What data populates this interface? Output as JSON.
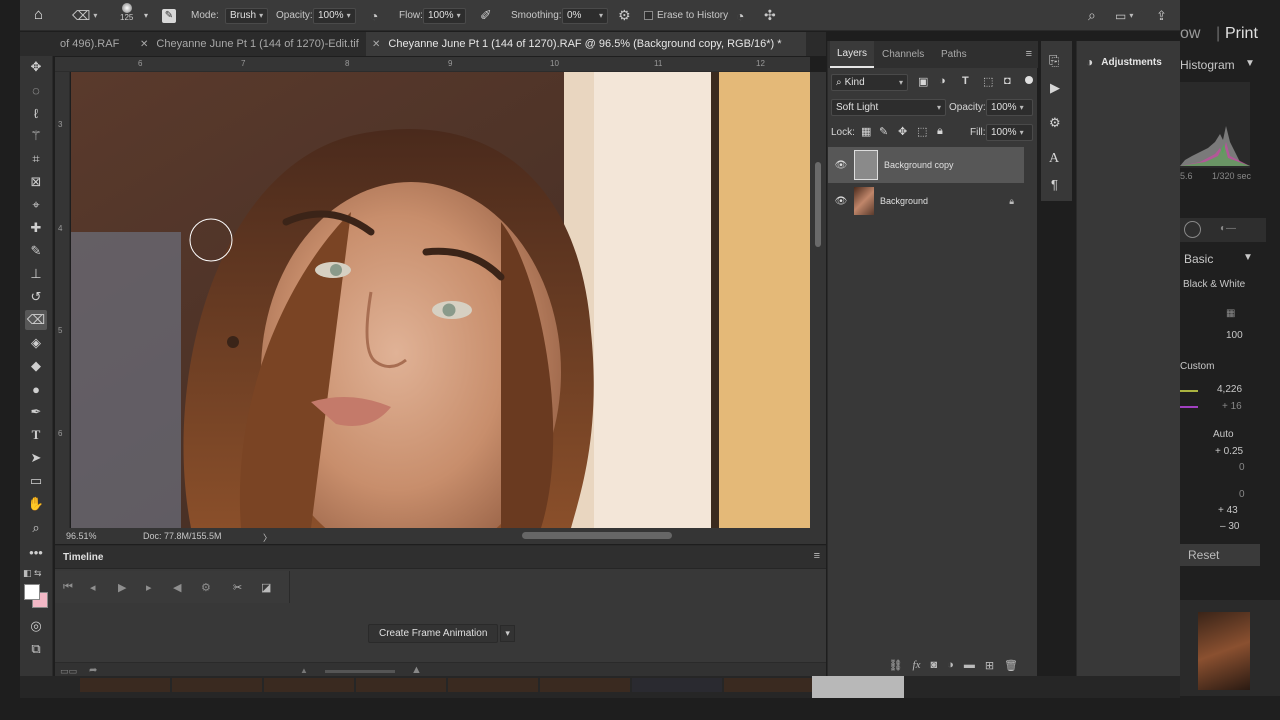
{
  "options_bar": {
    "brush_size": "125",
    "mode_label": "Mode:",
    "mode_value": "Brush",
    "opacity_label": "Opacity:",
    "opacity_value": "100%",
    "flow_label": "Flow:",
    "flow_value": "100%",
    "smoothing_label": "Smoothing:",
    "smoothing_value": "0%",
    "erase_history_label": "Erase to History"
  },
  "tabs": [
    {
      "label": "of 496).RAF"
    },
    {
      "label": "Cheyanne June Pt 1 (144 of 1270)-Edit.tif"
    },
    {
      "label": "Cheyanne June Pt 1 (144 of 1270).RAF @ 96.5% (Background copy, RGB/16*) *"
    }
  ],
  "ruler_h": [
    "6",
    "7",
    "8",
    "9",
    "10",
    "11",
    "12"
  ],
  "ruler_v": [
    "3",
    "4",
    "5",
    "6"
  ],
  "status": {
    "zoom": "96.51%",
    "doc": "Doc: 77.8M/155.5M",
    "arrow": "〉"
  },
  "timeline": {
    "title": "Timeline",
    "create_button": "Create Frame Animation"
  },
  "layers_panel": {
    "tabs": [
      "Layers",
      "Channels",
      "Paths"
    ],
    "kind_label": "Kind",
    "blend_mode": "Soft Light",
    "opacity_label": "Opacity:",
    "opacity_value": "100%",
    "lock_label": "Lock:",
    "fill_label": "Fill:",
    "fill_value": "100%",
    "layers": [
      {
        "name": "Background copy"
      },
      {
        "name": "Background"
      }
    ]
  },
  "adjustments": {
    "title": "Adjustments"
  },
  "lightroom": {
    "top_left": "ow",
    "top_right": "Print",
    "histogram": "Histogram",
    "hist_left": "5.6",
    "hist_right": "1/320 sec",
    "basic": "Basic",
    "bw": "Black & White",
    "val_100": "100",
    "custom": "Custom",
    "temp": "4,226",
    "tint": "+ 16",
    "auto": "Auto",
    "exposure": "+ 0.25",
    "contrast": "0",
    "highlights": "0",
    "shadows": "+ 43",
    "whites": "– 30",
    "reset": "Reset"
  },
  "colors": {
    "panel_bg": "#383838",
    "options_bg": "#3a3a3a",
    "selected_layer": "#575757",
    "background_color": "#f2b8c6"
  }
}
